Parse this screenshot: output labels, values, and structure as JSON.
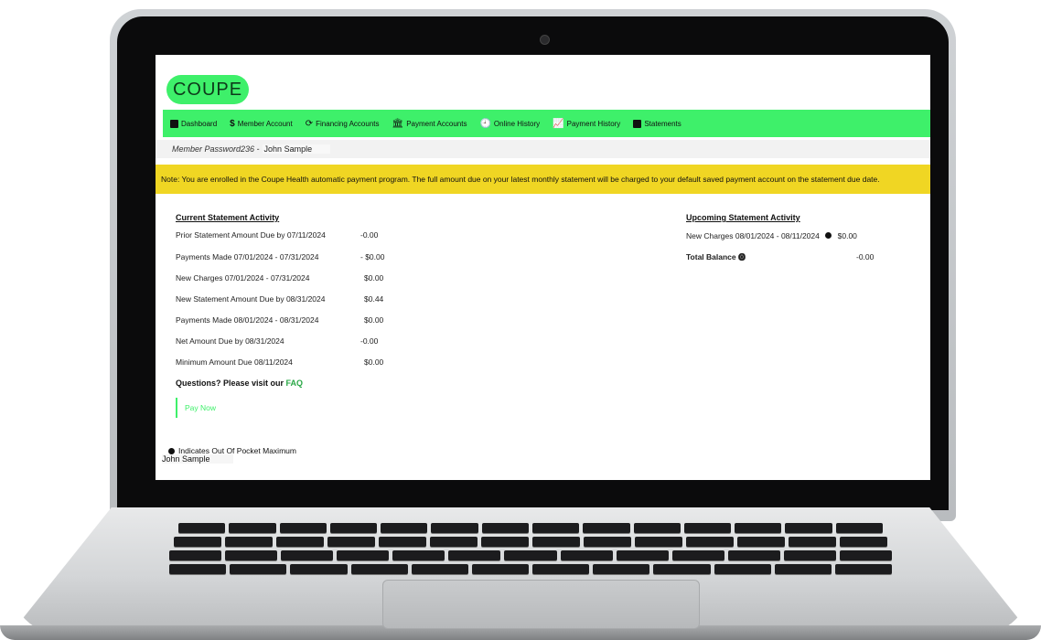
{
  "logo": "COUPE",
  "nav": [
    {
      "label": "Dashboard",
      "icon": "dashboard-icon"
    },
    {
      "label": "Member Account",
      "icon": "dollar-icon"
    },
    {
      "label": "Financing Accounts",
      "icon": "refresh-icon"
    },
    {
      "label": "Payment Accounts",
      "icon": "bank-icon"
    },
    {
      "label": "Online History",
      "icon": "clock-icon"
    },
    {
      "label": "Payment History",
      "icon": "chart-icon"
    },
    {
      "label": "Statements",
      "icon": "document-icon"
    }
  ],
  "member": {
    "label": "Member Password236 -",
    "name": "John Sample"
  },
  "notice": "Note: You are enrolled in the Coupe Health automatic payment program. The full amount due on your latest monthly statement will be charged to your default saved payment account on the statement due date.",
  "current": {
    "title": "Current Statement Activity",
    "rows": [
      {
        "label": "Prior Statement Amount Due by 07/11/2024",
        "amount": "-0.00"
      },
      {
        "label": "Payments Made 07/01/2024 - 07/31/2024",
        "amount": "- $0.00"
      },
      {
        "label": "New Charges 07/01/2024 - 07/31/2024",
        "amount": "$0.00"
      },
      {
        "label": "New Statement Amount Due by 08/31/2024",
        "amount": "$0.44"
      },
      {
        "label": "Payments Made 08/01/2024 - 08/31/2024",
        "amount": "$0.00"
      },
      {
        "label": "Net Amount Due by 08/31/2024",
        "amount": "-0.00"
      },
      {
        "label": "Minimum Amount Due 08/11/2024",
        "amount": "$0.00"
      }
    ]
  },
  "upcoming": {
    "title": "Upcoming Statement Activity",
    "new_charges_label": "New Charges 08/01/2024 - 08/11/2024",
    "new_charges_amount": "$0.00",
    "total_label": "Total Balance",
    "total_amount": "-0.00"
  },
  "questions_text": "Questions? Please visit our ",
  "faq_link": "FAQ",
  "pay_now": "Pay Now",
  "legend": "Indicates Out Of Pocket Maximum",
  "footer_name": "John Sample",
  "colors": {
    "brand_green": "#3ef06a",
    "notice_yellow": "#f0d623"
  }
}
